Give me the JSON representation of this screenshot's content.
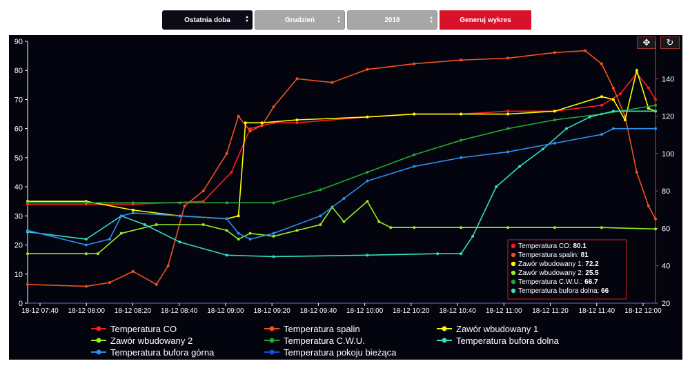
{
  "controls": {
    "period": "Ostatnia doba",
    "month": "Grudzień",
    "year": "2018",
    "generate_label": "Generuj wykres"
  },
  "toolbar": {
    "pan_icon": "pan-icon",
    "reset_icon": "reset-zoom-icon"
  },
  "colors": {
    "background": "#04040f",
    "axis_left": "#ffffff",
    "axis_right": "#e8421e",
    "tooltip_border": "#cc2020",
    "generate_button": "#d8122a"
  },
  "chart_data": {
    "type": "line",
    "x_tick_labels": [
      "18-12 07:40",
      "18-12 08:00",
      "18-12 08:20",
      "18-12 08:40",
      "18-12 09:00",
      "18-12 09:20",
      "18-12 09:40",
      "18-12 10:00",
      "18-12 10:20",
      "18-12 10:40",
      "18-12 11:00",
      "18-12 11:20",
      "18-12 11:40",
      "18-12 12:00"
    ],
    "x_range": [
      "07:35",
      "12:03"
    ],
    "y_left": {
      "min": 0,
      "max": 90,
      "ticks": [
        0,
        10,
        20,
        30,
        40,
        50,
        60,
        70,
        80,
        90
      ]
    },
    "y_right": {
      "min": 20,
      "max": 160,
      "ticks": [
        20,
        40,
        60,
        80,
        100,
        120,
        140
      ]
    },
    "grid": false,
    "legend_position": "bottom",
    "series": [
      {
        "name": "Temperatura CO",
        "color": "#ff1e1e",
        "axis": "left",
        "points": [
          [
            "07:35",
            34
          ],
          [
            "08:00",
            34
          ],
          [
            "08:20",
            34
          ],
          [
            "08:50",
            35
          ],
          [
            "09:02",
            45
          ],
          [
            "09:10",
            60
          ],
          [
            "09:20",
            62
          ],
          [
            "09:30",
            62
          ],
          [
            "10:00",
            64
          ],
          [
            "10:20",
            65
          ],
          [
            "10:40",
            65
          ],
          [
            "11:00",
            66
          ],
          [
            "11:20",
            66
          ],
          [
            "11:40",
            68
          ],
          [
            "11:48",
            72
          ],
          [
            "11:55",
            79
          ],
          [
            "12:00",
            74
          ],
          [
            "12:03",
            70
          ]
        ]
      },
      {
        "name": "Temperatura spalin",
        "color": "#f4511e",
        "axis": "right",
        "points": [
          [
            "07:35",
            30
          ],
          [
            "08:00",
            29
          ],
          [
            "08:10",
            31
          ],
          [
            "08:20",
            37
          ],
          [
            "08:30",
            30
          ],
          [
            "08:35",
            40
          ],
          [
            "08:42",
            72
          ],
          [
            "08:50",
            80
          ],
          [
            "09:00",
            100
          ],
          [
            "09:05",
            120
          ],
          [
            "09:10",
            112
          ],
          [
            "09:15",
            115
          ],
          [
            "09:20",
            125
          ],
          [
            "09:30",
            140
          ],
          [
            "09:45",
            138
          ],
          [
            "10:00",
            145
          ],
          [
            "10:20",
            148
          ],
          [
            "10:40",
            150
          ],
          [
            "11:00",
            151
          ],
          [
            "11:20",
            154
          ],
          [
            "11:33",
            155
          ],
          [
            "11:40",
            148
          ],
          [
            "11:45",
            135
          ],
          [
            "11:50",
            120
          ],
          [
            "11:55",
            90
          ],
          [
            "12:00",
            72
          ],
          [
            "12:03",
            65
          ]
        ]
      },
      {
        "name": "Zawór wbudowany 1",
        "color": "#ffff00",
        "axis": "left",
        "points": [
          [
            "07:35",
            35
          ],
          [
            "08:00",
            35
          ],
          [
            "08:20",
            32
          ],
          [
            "08:40",
            30
          ],
          [
            "09:00",
            29
          ],
          [
            "09:05",
            30
          ],
          [
            "09:08",
            62
          ],
          [
            "09:15",
            62
          ],
          [
            "09:30",
            63
          ],
          [
            "10:00",
            64
          ],
          [
            "10:20",
            65
          ],
          [
            "10:40",
            65
          ],
          [
            "11:00",
            65
          ],
          [
            "11:20",
            66
          ],
          [
            "11:40",
            71
          ],
          [
            "11:45",
            70
          ],
          [
            "11:50",
            63
          ],
          [
            "11:55",
            80
          ],
          [
            "12:00",
            67
          ],
          [
            "12:03",
            66
          ]
        ]
      },
      {
        "name": "Zawór wbudowany 2",
        "color": "#99ee22",
        "axis": "left",
        "points": [
          [
            "07:35",
            17
          ],
          [
            "08:00",
            17
          ],
          [
            "08:05",
            17
          ],
          [
            "08:15",
            24
          ],
          [
            "08:30",
            27
          ],
          [
            "08:50",
            27
          ],
          [
            "09:00",
            25
          ],
          [
            "09:05",
            22
          ],
          [
            "09:10",
            24
          ],
          [
            "09:20",
            23
          ],
          [
            "09:30",
            25
          ],
          [
            "09:40",
            27
          ],
          [
            "09:45",
            33
          ],
          [
            "09:50",
            28
          ],
          [
            "10:00",
            35
          ],
          [
            "10:05",
            28
          ],
          [
            "10:10",
            26
          ],
          [
            "10:20",
            26
          ],
          [
            "10:40",
            26
          ],
          [
            "11:00",
            26
          ],
          [
            "11:20",
            26
          ],
          [
            "11:40",
            26
          ],
          [
            "12:03",
            25.5
          ]
        ]
      },
      {
        "name": "Temperatura C.W.U.",
        "color": "#22aa33",
        "axis": "left",
        "points": [
          [
            "07:35",
            34.5
          ],
          [
            "08:00",
            34.5
          ],
          [
            "08:20",
            34.5
          ],
          [
            "08:40",
            34.5
          ],
          [
            "09:00",
            34.5
          ],
          [
            "09:20",
            34.5
          ],
          [
            "09:40",
            39
          ],
          [
            "10:00",
            45
          ],
          [
            "10:20",
            51
          ],
          [
            "10:40",
            56
          ],
          [
            "11:00",
            60
          ],
          [
            "11:20",
            63
          ],
          [
            "11:40",
            65
          ],
          [
            "12:03",
            68
          ]
        ]
      },
      {
        "name": "Temperatura bufora dolna",
        "color": "#33e0c0",
        "axis": "left",
        "points": [
          [
            "07:35",
            24.5
          ],
          [
            "08:00",
            22
          ],
          [
            "08:15",
            30
          ],
          [
            "08:25",
            27
          ],
          [
            "08:40",
            21
          ],
          [
            "09:00",
            16.5
          ],
          [
            "09:20",
            16
          ],
          [
            "10:00",
            16.5
          ],
          [
            "10:30",
            17
          ],
          [
            "10:40",
            17
          ],
          [
            "10:45",
            23
          ],
          [
            "10:55",
            40
          ],
          [
            "11:05",
            47
          ],
          [
            "11:15",
            53
          ],
          [
            "11:25",
            60
          ],
          [
            "11:35",
            64
          ],
          [
            "11:45",
            66
          ],
          [
            "12:03",
            66
          ]
        ]
      },
      {
        "name": "Temperatura bufora górna",
        "color": "#2f8ff0",
        "axis": "left",
        "points": [
          [
            "07:35",
            25
          ],
          [
            "08:00",
            20
          ],
          [
            "08:10",
            22
          ],
          [
            "08:15",
            30
          ],
          [
            "08:20",
            31
          ],
          [
            "08:40",
            30
          ],
          [
            "09:00",
            29
          ],
          [
            "09:05",
            24
          ],
          [
            "09:10",
            22
          ],
          [
            "09:20",
            24
          ],
          [
            "09:40",
            30
          ],
          [
            "09:50",
            36
          ],
          [
            "10:00",
            42
          ],
          [
            "10:20",
            47
          ],
          [
            "10:40",
            50
          ],
          [
            "11:00",
            52
          ],
          [
            "11:20",
            55
          ],
          [
            "11:40",
            58
          ],
          [
            "11:45",
            60
          ],
          [
            "12:03",
            60
          ]
        ]
      },
      {
        "name": "Temperatura pokoju bieżąca",
        "color": "#1a4fe0",
        "axis": "left",
        "points": []
      }
    ],
    "tooltip": {
      "entries": [
        {
          "label": "Temperatura CO:",
          "value": "80.1",
          "color": "#ff1e1e"
        },
        {
          "label": "Temperatura spalin:",
          "value": "81",
          "color": "#f4511e"
        },
        {
          "label": "Zawór wbudowany 1:",
          "value": "72.2",
          "color": "#ffff00"
        },
        {
          "label": "Zawór wbudowany 2:",
          "value": "25.5",
          "color": "#99ee22"
        },
        {
          "label": "Temperatura C.W.U.:",
          "value": "66.7",
          "color": "#22aa33"
        },
        {
          "label": "Temperatura bufora dolna:",
          "value": "66",
          "color": "#33e0c0"
        }
      ]
    }
  }
}
